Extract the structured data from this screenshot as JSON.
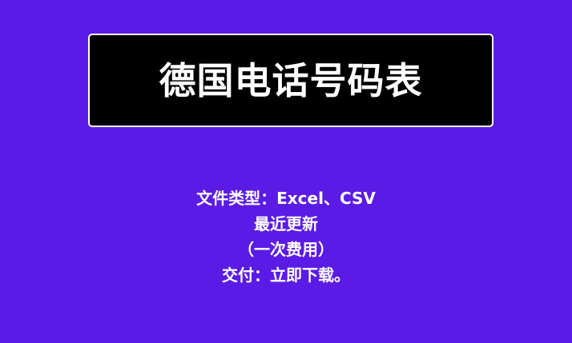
{
  "colors": {
    "background": "#5b1be6",
    "title_box": "#000000",
    "text": "#ffffff"
  },
  "title": "德国电话号码表",
  "info_lines": [
    "文件类型：Excel、CSV",
    "最近更新",
    "（一次费用）",
    "交付：立即下载。"
  ]
}
